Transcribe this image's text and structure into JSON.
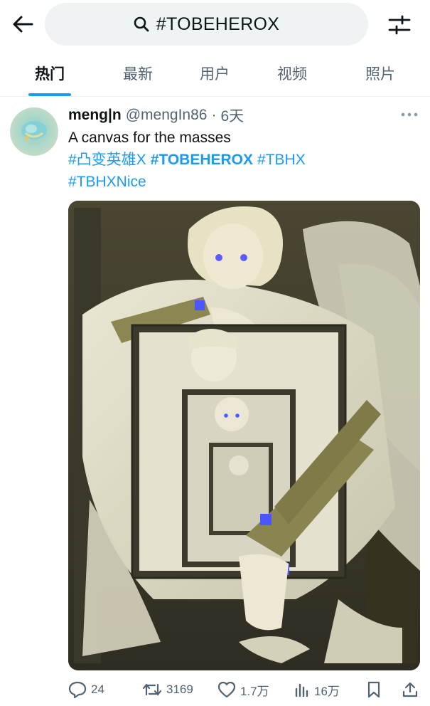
{
  "search": {
    "query": "#TOBEHEROX"
  },
  "tabs": [
    {
      "label": "热门",
      "active": true
    },
    {
      "label": "最新",
      "active": false
    },
    {
      "label": "用户",
      "active": false
    },
    {
      "label": "视频",
      "active": false
    },
    {
      "label": "照片",
      "active": false
    }
  ],
  "post": {
    "display_name": "meng|n",
    "handle": "@mengIn86",
    "separator": "·",
    "time": "6天",
    "text": "A canvas for the masses",
    "hashtags": [
      "#凸变英雄X",
      "#TOBEHEROX",
      "#TBHX",
      "#TBHXNice"
    ],
    "media_icon": "illustration-image",
    "actions": {
      "replies": "24",
      "reposts": "3169",
      "likes": "1.7万",
      "views": "16万"
    }
  },
  "colors": {
    "accent": "#1d9bf0",
    "text_primary": "#0f1419",
    "text_secondary": "#536471",
    "search_bg": "#eff3f4"
  }
}
